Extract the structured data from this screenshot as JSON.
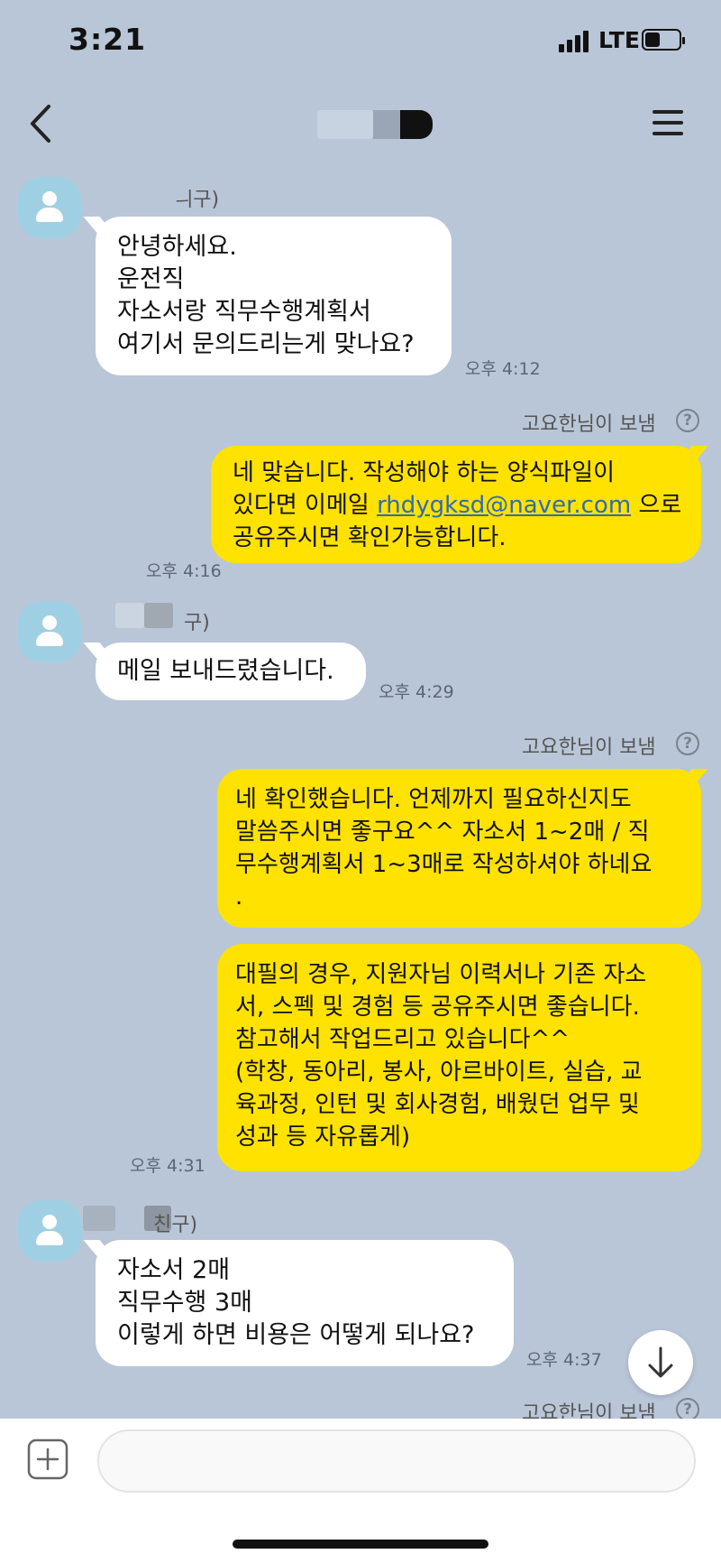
{
  "status_bar": {
    "time": "3:21",
    "network": "LTE",
    "battery_icon": "battery-icon",
    "signal_icon": "signal-bars-icon"
  },
  "header": {
    "back_icon": "chevron-left-icon",
    "menu_icon": "hamburger-menu-icon"
  },
  "messages": [
    {
      "sender_fragment": "ㅢ구)",
      "lines": [
        "안녕하세요.",
        "운전직",
        "자소서랑 직무수행계획서",
        "여기서 문의드리는게 맞나요?"
      ],
      "time": "오후 4:12"
    },
    {
      "sent_by": "고요한님이 보냄",
      "lines_pre": "네 맞습니다. 작성해야 하는 양식파일이",
      "line2_pre": "있다면 이메일 ",
      "email": "rhdygksd@naver.com",
      "line2_post": " 으로",
      "line3": "공유주시면 확인가능합니다.",
      "time": "오후 4:16"
    },
    {
      "sender_fragment": "구)",
      "lines": [
        "메일 보내드렸습니다."
      ],
      "time": "오후 4:29"
    },
    {
      "sent_by": "고요한님이 보냄",
      "lines": [
        "네 확인했습니다. 언제까지 필요하신지도",
        "말씀주시면 좋구요^^ 자소서 1~2매 / 직",
        "무수행계획서 1~3매로 작성하셔야 하네요",
        "."
      ]
    },
    {
      "lines": [
        "대필의 경우, 지원자님 이력서나 기존 자소",
        "서, 스펙 및 경험 등 공유주시면 좋습니다.",
        "참고해서 작업드리고 있습니다^^",
        "(학창, 동아리, 봉사, 아르바이트, 실습, 교",
        "육과정, 인턴 및 회사경험, 배웠던 업무 및",
        "성과 등 자유롭게)"
      ],
      "time": "오후 4:31"
    },
    {
      "sender_fragment": "친구)",
      "lines": [
        "자소서 2매",
        "직무수행 3매",
        "이렇게 하면 비용은 어떻게 되나요?"
      ],
      "time": "오후 4:37"
    },
    {
      "sent_by": "고요한님이 보냄"
    }
  ],
  "help_symbol": "?",
  "composer": {
    "placeholder": "",
    "plus_icon": "plus-square-icon"
  },
  "scroll_icon": "arrow-down-icon",
  "colors": {
    "background": "#b9c6d7",
    "outgoing": "#ffe200",
    "incoming": "#ffffff",
    "avatar": "#9fcfe3"
  }
}
